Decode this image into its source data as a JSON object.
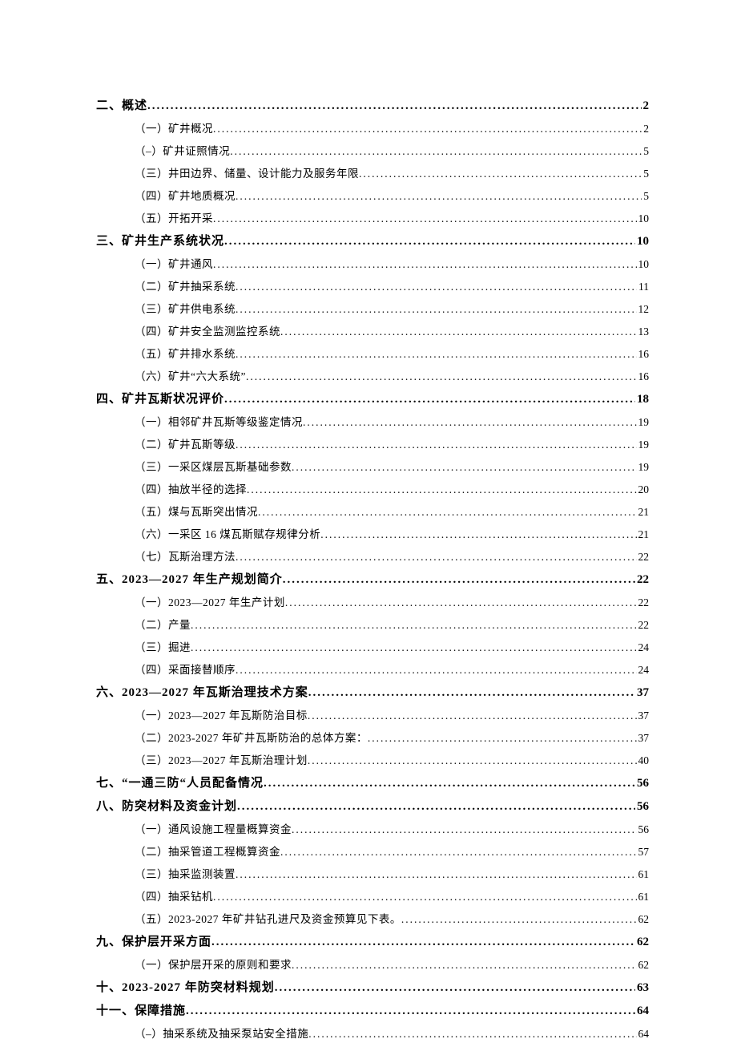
{
  "toc": [
    {
      "level": 1,
      "label": "二、概述",
      "page": "2"
    },
    {
      "level": 2,
      "label": "（一）矿井概况",
      "page": "2"
    },
    {
      "level": 2,
      "label": "（–）矿井证照情况",
      "page": "5"
    },
    {
      "level": 2,
      "label": "（三）井田边界、储量、设计能力及服务年限",
      "page": "5"
    },
    {
      "level": 2,
      "label": "（四）矿井地质概况",
      "page": "5"
    },
    {
      "level": 2,
      "label": "（五）开拓开采",
      "page": "10"
    },
    {
      "level": 1,
      "label": "三、矿井生产系统状况",
      "page": "10"
    },
    {
      "level": 2,
      "label": "（一）矿井通风",
      "page": "10"
    },
    {
      "level": 2,
      "label": "（二）矿井抽采系统",
      "page": "11"
    },
    {
      "level": 2,
      "label": "（三）矿井供电系统",
      "page": "12"
    },
    {
      "level": 2,
      "label": "（四）矿井安全监测监控系统",
      "page": "13"
    },
    {
      "level": 2,
      "label": "（五）矿井排水系统",
      "page": "16"
    },
    {
      "level": 2,
      "label": "（六）矿井“六大系统”",
      "page": "16"
    },
    {
      "level": 1,
      "label": "四、矿井瓦斯状况评价",
      "page": "18"
    },
    {
      "level": 2,
      "label": "（一）相邻矿井瓦斯等级鉴定情况",
      "page": "19"
    },
    {
      "level": 2,
      "label": "（二）矿井瓦斯等级",
      "page": "19"
    },
    {
      "level": 2,
      "label": "（三）一采区煤层瓦斯基础参数",
      "page": "19"
    },
    {
      "level": 2,
      "label": "（四）抽放半径的选择",
      "page": "20"
    },
    {
      "level": 2,
      "label": "（五）煤与瓦斯突出情况",
      "page": "21"
    },
    {
      "level": 2,
      "label": "（六）一采区 16 煤瓦斯赋存规律分析",
      "page": "21"
    },
    {
      "level": 2,
      "label": "（七）瓦斯治理方法",
      "page": "22"
    },
    {
      "level": 1,
      "label": "五、2023—2027 年生产规划简介",
      "page": "22"
    },
    {
      "level": 2,
      "label": "（一）2023—2027 年生产计划",
      "page": "22"
    },
    {
      "level": 2,
      "label": "（二）产量",
      "page": "22"
    },
    {
      "level": 2,
      "label": "（三）掘进",
      "page": "24"
    },
    {
      "level": 2,
      "label": "（四）采面接替顺序",
      "page": "24"
    },
    {
      "level": 1,
      "label": "六、2023—2027 年瓦斯治理技术方案",
      "page": "37"
    },
    {
      "level": 2,
      "label": "（一）2023—2027 年瓦斯防治目标",
      "page": "37"
    },
    {
      "level": 2,
      "label": "（二）2023-2027 年矿井瓦斯防治的总体方案：",
      "page": "37"
    },
    {
      "level": 2,
      "label": "（三）2023—2027 年瓦斯治理计划",
      "page": "40"
    },
    {
      "level": 1,
      "label": "七、“一通三防“人员配备情况",
      "page": "56"
    },
    {
      "level": 1,
      "label": "八、防突材料及资金计划",
      "page": "56"
    },
    {
      "level": 2,
      "label": "（一）通风设施工程量概算资金",
      "page": "56"
    },
    {
      "level": 2,
      "label": "（二）抽采管道工程概算资金",
      "page": "57"
    },
    {
      "level": 2,
      "label": "（三）抽采监测装置",
      "page": "61"
    },
    {
      "level": 2,
      "label": "（四）抽采钻机",
      "page": "61"
    },
    {
      "level": 2,
      "label": "（五）2023-2027 年矿井钻孔进尺及资金预算见下表。",
      "page": "62"
    },
    {
      "level": 1,
      "label": "九、保护层开采方面",
      "page": "62"
    },
    {
      "level": 2,
      "label": "（一）保护层开采的原则和要求",
      "page": "62"
    },
    {
      "level": 1,
      "label": "十、2023-2027 年防突材料规划",
      "page": "63"
    },
    {
      "level": 1,
      "label": "十一、保障措施",
      "page": "64"
    },
    {
      "level": 2,
      "label": "（–）抽采系统及抽采泵站安全措施",
      "page": "64"
    }
  ]
}
